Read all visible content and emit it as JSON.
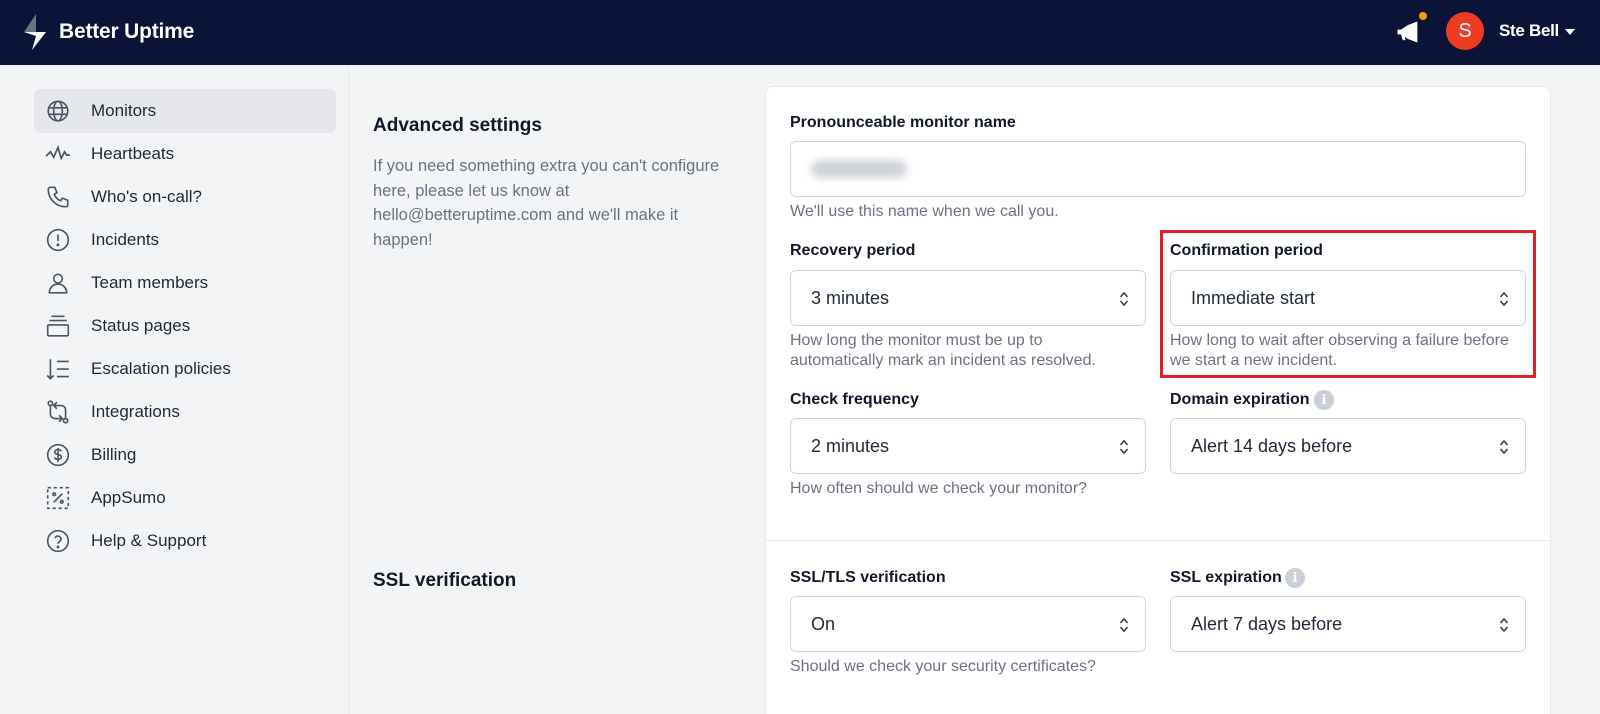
{
  "app": {
    "name": "Better Uptime"
  },
  "user": {
    "initial": "S",
    "name": "Ste Bell"
  },
  "sidebar": {
    "items": [
      {
        "label": "Monitors",
        "icon": "globe-icon",
        "active": true
      },
      {
        "label": "Heartbeats",
        "icon": "pulse-icon"
      },
      {
        "label": "Who's on-call?",
        "icon": "phone-icon"
      },
      {
        "label": "Incidents",
        "icon": "alert-circle-icon"
      },
      {
        "label": "Team members",
        "icon": "user-icon"
      },
      {
        "label": "Status pages",
        "icon": "stack-icon"
      },
      {
        "label": "Escalation policies",
        "icon": "sort-list-icon"
      },
      {
        "label": "Integrations",
        "icon": "exchange-icon"
      },
      {
        "label": "Billing",
        "icon": "dollar-circle-icon"
      },
      {
        "label": "AppSumo",
        "icon": "percent-box-icon"
      },
      {
        "label": "Help & Support",
        "icon": "help-circle-icon"
      }
    ]
  },
  "advanced": {
    "title": "Advanced settings",
    "description": "If you need something extra you can't configure here, please let us know at hello@betteruptime.com and we'll make it happen!",
    "pronounceable_name": {
      "label": "Pronounceable monitor name",
      "hint": "We'll use this name when we call you."
    },
    "recovery_period": {
      "label": "Recovery period",
      "value": "3 minutes",
      "hint": "How long the monitor must be up to automatically mark an incident as resolved."
    },
    "confirmation_period": {
      "label": "Confirmation period",
      "value": "Immediate start",
      "hint": "How long to wait after observing a failure before we start a new incident."
    },
    "check_frequency": {
      "label": "Check frequency",
      "value": "2 minutes",
      "hint": "How often should we check your monitor?"
    },
    "domain_expiration": {
      "label": "Domain expiration",
      "value": "Alert 14 days before"
    }
  },
  "ssl": {
    "title": "SSL verification",
    "verification": {
      "label": "SSL/TLS verification",
      "value": "On",
      "hint": "Should we check your security certificates?"
    },
    "expiration": {
      "label": "SSL expiration",
      "value": "Alert 7 days before"
    }
  },
  "colors": {
    "topbar": "#0b1437",
    "avatar": "#ef3b24",
    "highlight": "#e11d2a"
  }
}
